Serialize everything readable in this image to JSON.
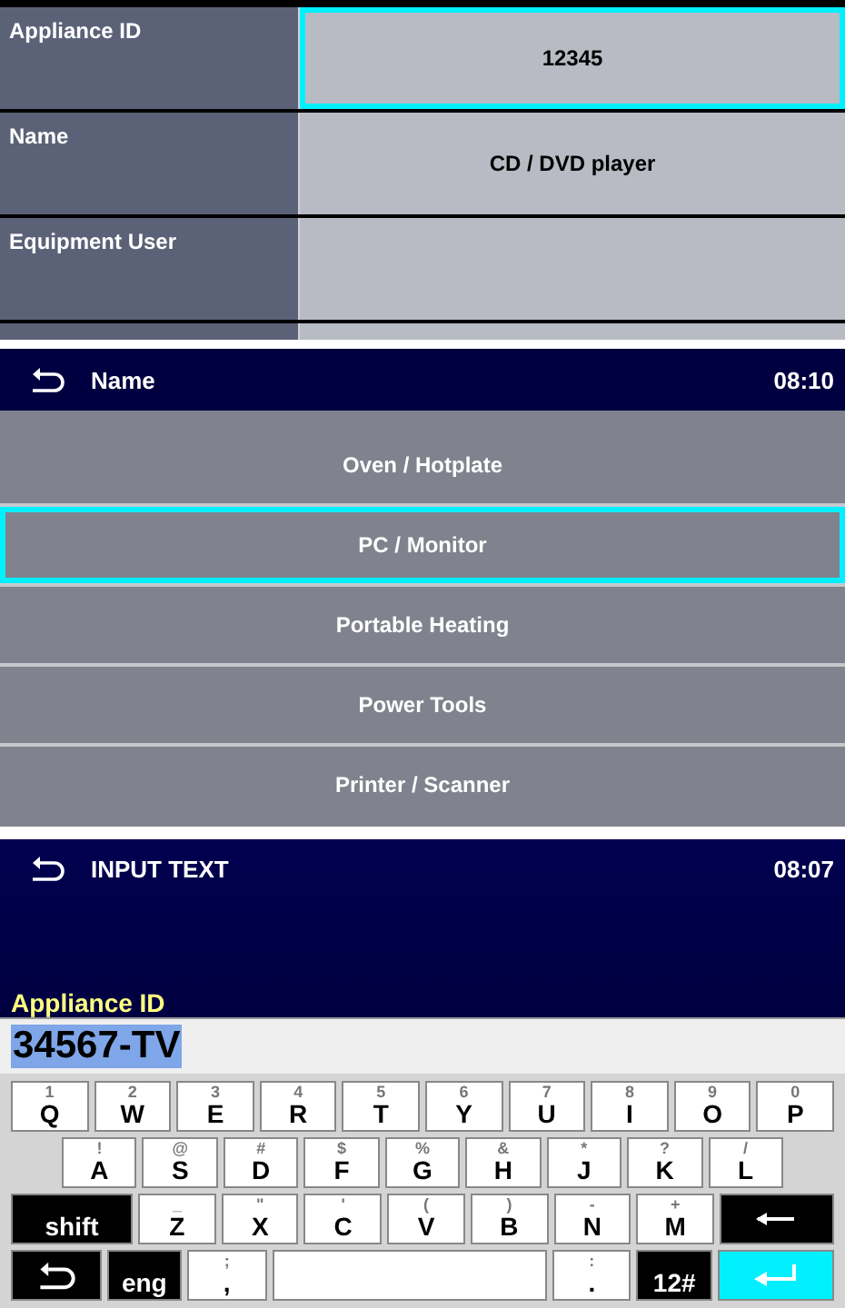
{
  "detail_form": {
    "rows": [
      {
        "label": "Appliance ID",
        "value": "12345",
        "selected": true
      },
      {
        "label": "Name",
        "value": "CD / DVD player",
        "selected": false
      },
      {
        "label": "Equipment User",
        "value": "",
        "selected": false
      }
    ]
  },
  "name_screen": {
    "title": "Name",
    "time": "08:10",
    "items": [
      {
        "label": "Oven / Hotplate",
        "selected": false
      },
      {
        "label": "PC / Monitor",
        "selected": true
      },
      {
        "label": "Portable Heating",
        "selected": false
      },
      {
        "label": "Power Tools",
        "selected": false
      },
      {
        "label": "Printer / Scanner",
        "selected": false
      }
    ]
  },
  "input_screen": {
    "title": "INPUT TEXT",
    "time": "08:07",
    "field_label": "Appliance ID",
    "value": "34567-TV",
    "value_selected": true
  },
  "keyboard": {
    "rows": [
      {
        "kind": "top",
        "keys": [
          {
            "kind": "char",
            "label": "Q",
            "alt": "1"
          },
          {
            "kind": "char",
            "label": "W",
            "alt": "2"
          },
          {
            "kind": "char",
            "label": "E",
            "alt": "3"
          },
          {
            "kind": "char",
            "label": "R",
            "alt": "4"
          },
          {
            "kind": "char",
            "label": "T",
            "alt": "5"
          },
          {
            "kind": "char",
            "label": "Y",
            "alt": "6"
          },
          {
            "kind": "char",
            "label": "U",
            "alt": "7"
          },
          {
            "kind": "char",
            "label": "I",
            "alt": "8"
          },
          {
            "kind": "char",
            "label": "O",
            "alt": "9"
          },
          {
            "kind": "char",
            "label": "P",
            "alt": "0"
          }
        ]
      },
      {
        "kind": "home",
        "keys": [
          {
            "kind": "char",
            "label": "A",
            "alt": "!"
          },
          {
            "kind": "char",
            "label": "S",
            "alt": "@"
          },
          {
            "kind": "char",
            "label": "D",
            "alt": "#"
          },
          {
            "kind": "char",
            "label": "F",
            "alt": "$"
          },
          {
            "kind": "char",
            "label": "G",
            "alt": "%"
          },
          {
            "kind": "char",
            "label": "H",
            "alt": "&"
          },
          {
            "kind": "char",
            "label": "J",
            "alt": "*"
          },
          {
            "kind": "char",
            "label": "K",
            "alt": "?"
          },
          {
            "kind": "char",
            "label": "L",
            "alt": "/"
          }
        ]
      },
      {
        "kind": "bottom",
        "keys": [
          {
            "kind": "shift",
            "label": "shift"
          },
          {
            "kind": "char",
            "label": "Z",
            "alt": "_"
          },
          {
            "kind": "char",
            "label": "X",
            "alt": "\""
          },
          {
            "kind": "char",
            "label": "C",
            "alt": "'"
          },
          {
            "kind": "char",
            "label": "V",
            "alt": "("
          },
          {
            "kind": "char",
            "label": "B",
            "alt": ")"
          },
          {
            "kind": "char",
            "label": "N",
            "alt": "-"
          },
          {
            "kind": "char",
            "label": "M",
            "alt": "+"
          },
          {
            "kind": "backspace"
          }
        ]
      },
      {
        "kind": "space",
        "keys": [
          {
            "kind": "back"
          },
          {
            "kind": "lang",
            "label": "eng"
          },
          {
            "kind": "char",
            "label": ",",
            "alt": ";"
          },
          {
            "kind": "space"
          },
          {
            "kind": "char",
            "label": ".",
            "alt": ":"
          },
          {
            "kind": "lang",
            "label": "12#"
          },
          {
            "kind": "enter"
          }
        ]
      }
    ]
  }
}
